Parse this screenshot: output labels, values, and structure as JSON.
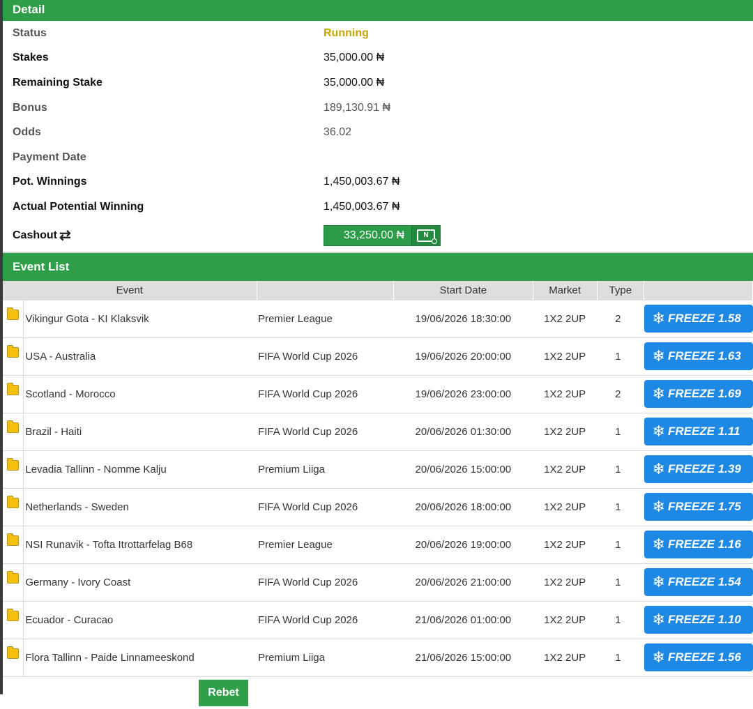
{
  "detail": {
    "header": "Detail",
    "rows": [
      {
        "label": "Status",
        "value": "Running"
      },
      {
        "label": "Stakes",
        "value": "35,000.00 ₦"
      },
      {
        "label": "Remaining Stake",
        "value": "35,000.00 ₦"
      },
      {
        "label": "Bonus",
        "value": "189,130.91 ₦"
      },
      {
        "label": "Odds",
        "value": "36.02"
      },
      {
        "label": "Payment Date",
        "value": ""
      },
      {
        "label": "Pot. Winnings",
        "value": "1,450,003.67 ₦"
      },
      {
        "label": "Actual Potential Winning",
        "value": "1,450,003.67 ₦"
      }
    ],
    "cashout": {
      "label": "Cashout",
      "amount": "33,250.00 ₦",
      "icon": "refresh-icon",
      "button_icon": "money-icon"
    }
  },
  "events": {
    "header": "Event List",
    "columns": [
      "Event",
      "",
      "Start Date",
      "Market",
      "Type"
    ],
    "rows": [
      {
        "event": "Vikingur Gota - KI Klaksvik",
        "league": "Premier League",
        "date": "19/06/2026 18:30:00",
        "market": "1X2 2UP",
        "type": "2",
        "freeze": "FREEZE 1.58"
      },
      {
        "event": "USA - Australia",
        "league": "FIFA World Cup 2026",
        "date": "19/06/2026 20:00:00",
        "market": "1X2 2UP",
        "type": "1",
        "freeze": "FREEZE 1.63"
      },
      {
        "event": "Scotland - Morocco",
        "league": "FIFA World Cup 2026",
        "date": "19/06/2026 23:00:00",
        "market": "1X2 2UP",
        "type": "2",
        "freeze": "FREEZE 1.69"
      },
      {
        "event": "Brazil - Haiti",
        "league": "FIFA World Cup 2026",
        "date": "20/06/2026 01:30:00",
        "market": "1X2 2UP",
        "type": "1",
        "freeze": "FREEZE 1.11"
      },
      {
        "event": "Levadia Tallinn - Nomme Kalju",
        "league": "Premium Liiga",
        "date": "20/06/2026 15:00:00",
        "market": "1X2 2UP",
        "type": "1",
        "freeze": "FREEZE 1.39"
      },
      {
        "event": "Netherlands - Sweden",
        "league": "FIFA World Cup 2026",
        "date": "20/06/2026 18:00:00",
        "market": "1X2 2UP",
        "type": "1",
        "freeze": "FREEZE 1.75"
      },
      {
        "event": "NSI Runavik - Tofta Itrottarfelag B68",
        "league": "Premier League",
        "date": "20/06/2026 19:00:00",
        "market": "1X2 2UP",
        "type": "1",
        "freeze": "FREEZE 1.16"
      },
      {
        "event": "Germany - Ivory Coast",
        "league": "FIFA World Cup 2026",
        "date": "20/06/2026 21:00:00",
        "market": "1X2 2UP",
        "type": "1",
        "freeze": "FREEZE 1.54"
      },
      {
        "event": "Ecuador - Curacao",
        "league": "FIFA World Cup 2026",
        "date": "21/06/2026 01:00:00",
        "market": "1X2 2UP",
        "type": "1",
        "freeze": "FREEZE 1.10"
      },
      {
        "event": "Flora Tallinn - Paide Linnameeskond",
        "league": "Premium Liiga",
        "date": "21/06/2026 15:00:00",
        "market": "1X2 2UP",
        "type": "1",
        "freeze": "FREEZE 1.56"
      }
    ],
    "row_icon": "folder-icon",
    "freeze_icon": "snowflake-icon"
  },
  "rebet_label": "Rebet",
  "colors": {
    "header_green": "#2e9e48",
    "status_yellow": "#c9a400",
    "freeze_blue": "#1e88e5"
  }
}
